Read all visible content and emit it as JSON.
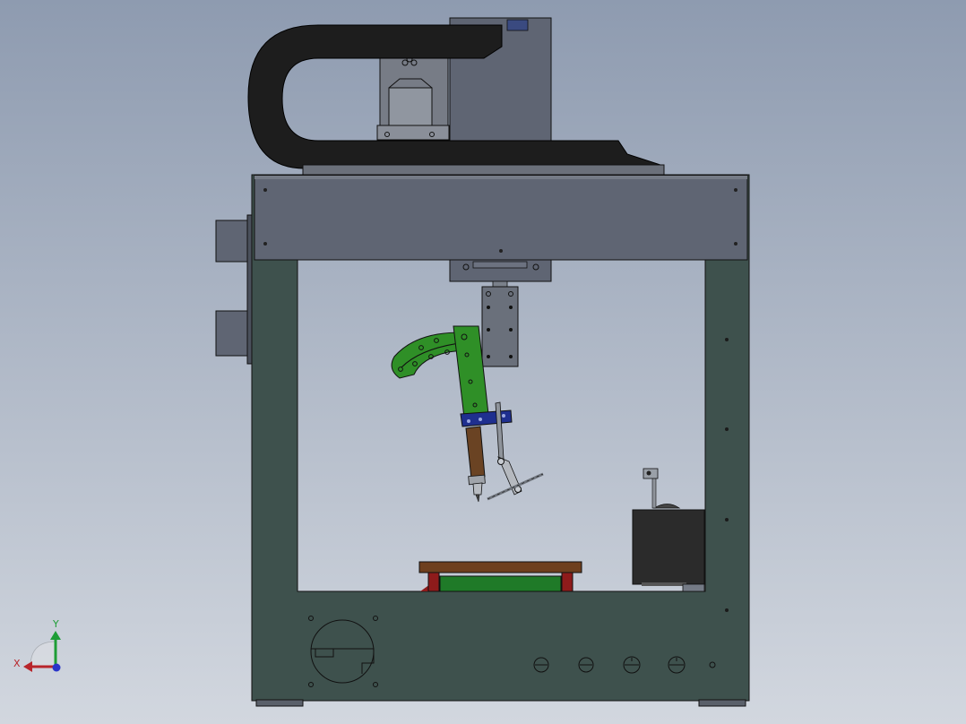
{
  "viewport": {
    "background_top": "#8e9bb0",
    "background_bottom": "#d2d7df"
  },
  "triad": {
    "x_label": "X",
    "y_label": "Y",
    "x_color": "#b8252b",
    "y_color": "#1e9d36",
    "z_color": "#2a35c9"
  },
  "colors": {
    "frame": "#3e514d",
    "beam": "#5f6573",
    "dark_part": "#2b2b2b",
    "cable_chain": "#1d1d1d",
    "bracket_green": "#2f8f27",
    "clamp_blue": "#1f2f8f",
    "iron_copper": "#6a4323",
    "board_wood": "#6e3f1e",
    "pcb_green": "#1f7a28",
    "fixture_red": "#8e1b1b",
    "edge": "#111111"
  }
}
